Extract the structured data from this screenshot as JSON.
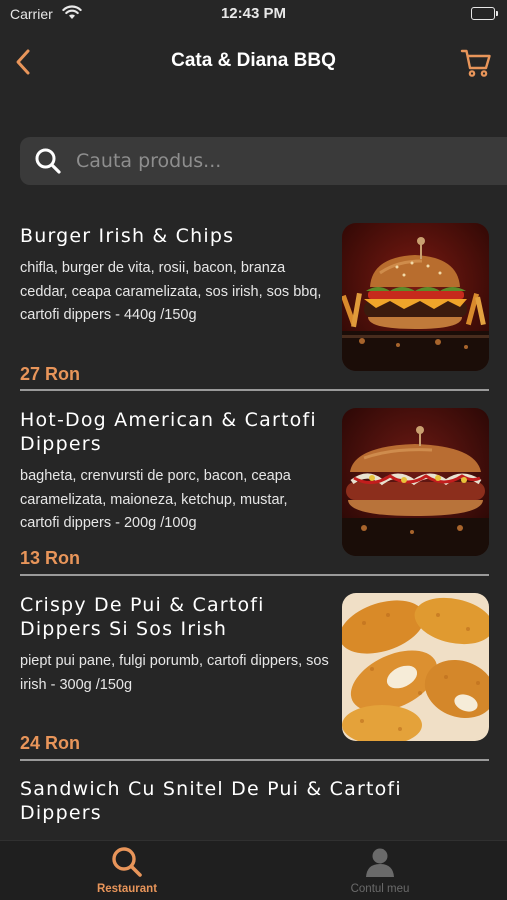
{
  "status_bar": {
    "carrier": "Carrier",
    "time": "12:43 PM"
  },
  "header": {
    "title": "Cata & Diana BBQ",
    "back_icon": "chevron-left-icon",
    "cart_icon": "shopping-cart-icon"
  },
  "search": {
    "placeholder": "Cauta produs...",
    "value": "",
    "icon": "search-icon"
  },
  "products": [
    {
      "name": "Burger Irish & Chips",
      "description": "chifla, burger de vita, rosii, bacon, branza ceddar, ceapa caramelizata, sos irish, sos bbq, cartofi dippers - 440g /150g",
      "price": "27 Ron",
      "image": "burger-photo"
    },
    {
      "name": "Hot-Dog American & Cartofi Dippers",
      "description": "bagheta, crenvursti de porc, bacon, ceapa caramelizata, maioneza, ketchup, mustar, cartofi dippers - 200g /100g",
      "price": "13 Ron",
      "image": "hotdog-photo"
    },
    {
      "name": "Crispy De Pui & Cartofi Dippers Si Sos Irish",
      "description": "piept pui pane, fulgi porumb, cartofi dippers, sos irish - 300g /150g",
      "price": "24 Ron",
      "image": "crispy-chicken-photo"
    },
    {
      "name": "Sandwich Cu Snitel De Pui & Cartofi Dippers",
      "description": "",
      "price": "",
      "image": ""
    }
  ],
  "tab_bar": {
    "tabs": [
      {
        "label": "Restaurant",
        "icon": "search-icon",
        "active": true
      },
      {
        "label": "Contul meu",
        "icon": "user-icon",
        "active": false
      }
    ]
  },
  "colors": {
    "background": "#262626",
    "accent": "#e8955a",
    "search_bg": "#3a3a3a",
    "tab_bar_bg": "#1f1f1f"
  }
}
